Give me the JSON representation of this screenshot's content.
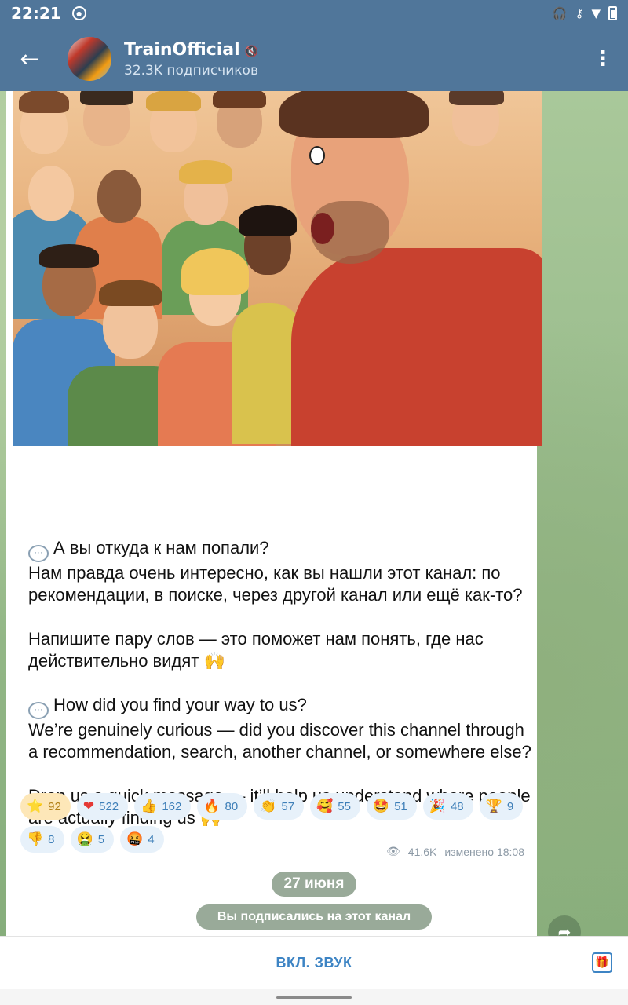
{
  "status_bar": {
    "time": "22:21",
    "icons": [
      "record-icon",
      "headphones-icon",
      "key-icon",
      "signal-icon",
      "wifi-icon",
      "battery-icon"
    ]
  },
  "header": {
    "back_icon": "arrow-left-icon",
    "channel_name": "TrainOfficial",
    "mute_icon": "muted-icon",
    "subscribers": "32.3K подписчиков",
    "menu_icon": "more-vertical-icon"
  },
  "message": {
    "image_alt": "illustration-crowd-angry-man",
    "paragraphs": [
      "А вы откуда к нам попали?",
      "Нам правда очень интересно, как вы нашли этот канал: по рекомендации, в поиске, через другой канал или ещё как-то?",
      "",
      "Напишите пару слов — это поможет нам понять, где нас действительно видят 🙌",
      "",
      "How did you find your way to us?",
      "We’re genuinely curious — did you discover this channel through a recommendation, search, another channel, or somewhere else?",
      "",
      "Drop us a quick message — it’ll help us understand where people are actually finding us 🙌"
    ],
    "reactions": [
      {
        "icon": "⭐",
        "count": "92",
        "active": true
      },
      {
        "icon": "❤",
        "count": "522"
      },
      {
        "icon": "👍",
        "count": "162"
      },
      {
        "icon": "🔥",
        "count": "80"
      },
      {
        "icon": "👏",
        "count": "57"
      },
      {
        "icon": "🥰",
        "count": "55"
      },
      {
        "icon": "🤩",
        "count": "51"
      },
      {
        "icon": "🎉",
        "count": "48"
      },
      {
        "icon": "🏆",
        "count": "9"
      },
      {
        "icon": "👎",
        "count": "8"
      },
      {
        "icon": "🤮",
        "count": "5"
      },
      {
        "icon": "🤬",
        "count": "4"
      }
    ],
    "views": "41.6K",
    "edited_time": "изменено 18:08"
  },
  "date_separator": "27 июня",
  "system_message": "Вы подписались на этот канал",
  "bottom": {
    "unmute_label": "ВКЛ. ЗВУК",
    "gift_icon": "gift-icon"
  },
  "colors": {
    "header": "#50769a",
    "accent": "#3d84c4",
    "reaction_bg": "#e7f1fa"
  }
}
